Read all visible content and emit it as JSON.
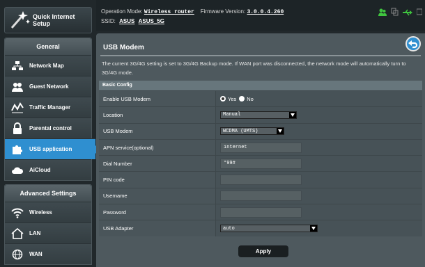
{
  "qis": {
    "label_line1": "Quick Internet",
    "label_line2": "Setup"
  },
  "sidebar": {
    "general_title": "General",
    "items": [
      {
        "label": "Network Map",
        "icon": "network-map-icon"
      },
      {
        "label": "Guest Network",
        "icon": "guest-network-icon"
      },
      {
        "label": "Traffic Manager",
        "icon": "traffic-manager-icon"
      },
      {
        "label": "Parental control",
        "icon": "lock-icon"
      },
      {
        "label": "USB application",
        "icon": "puzzle-icon",
        "active": true
      },
      {
        "label": "AiCloud",
        "icon": "cloud-icon"
      }
    ],
    "advanced_title": "Advanced Settings",
    "advanced_items": [
      {
        "label": "Wireless",
        "icon": "wifi-icon"
      },
      {
        "label": "LAN",
        "icon": "home-icon"
      },
      {
        "label": "WAN",
        "icon": "globe-icon"
      }
    ]
  },
  "topbar": {
    "mode_label": "Operation Mode:",
    "mode_value": "Wireless router",
    "fw_label": "Firmware Version:",
    "fw_value": "3.0.0.4.260",
    "ssid_label": "SSID:",
    "ssid_1": "ASUS",
    "ssid_2": "ASUS_5G"
  },
  "page": {
    "title": "USB Modem",
    "description": "The current 3G/4G setting is set to 3G/4G Backup mode. If WAN port was disconnected, the network mode will automatically turn to 3G/4G mode.",
    "section": "Basic Config",
    "fields": {
      "enable_label": "Enable USB Modem",
      "yes": "Yes",
      "no": "No",
      "location_label": "Location",
      "location_value": "Manual",
      "modem_label": "USB Modem",
      "modem_value": "WCDMA (UMTS)",
      "apn_label": "APN service(optional)",
      "apn_value": "internet",
      "dial_label": "Dial Number",
      "dial_value": "*99#",
      "pin_label": "PIN code",
      "user_label": "Username",
      "pass_label": "Password",
      "adapter_label": "USB Adapter",
      "adapter_value": "auto"
    },
    "apply": "Apply"
  },
  "colors": {
    "accent": "#2f8fd0",
    "status_green": "#3fc43f"
  }
}
